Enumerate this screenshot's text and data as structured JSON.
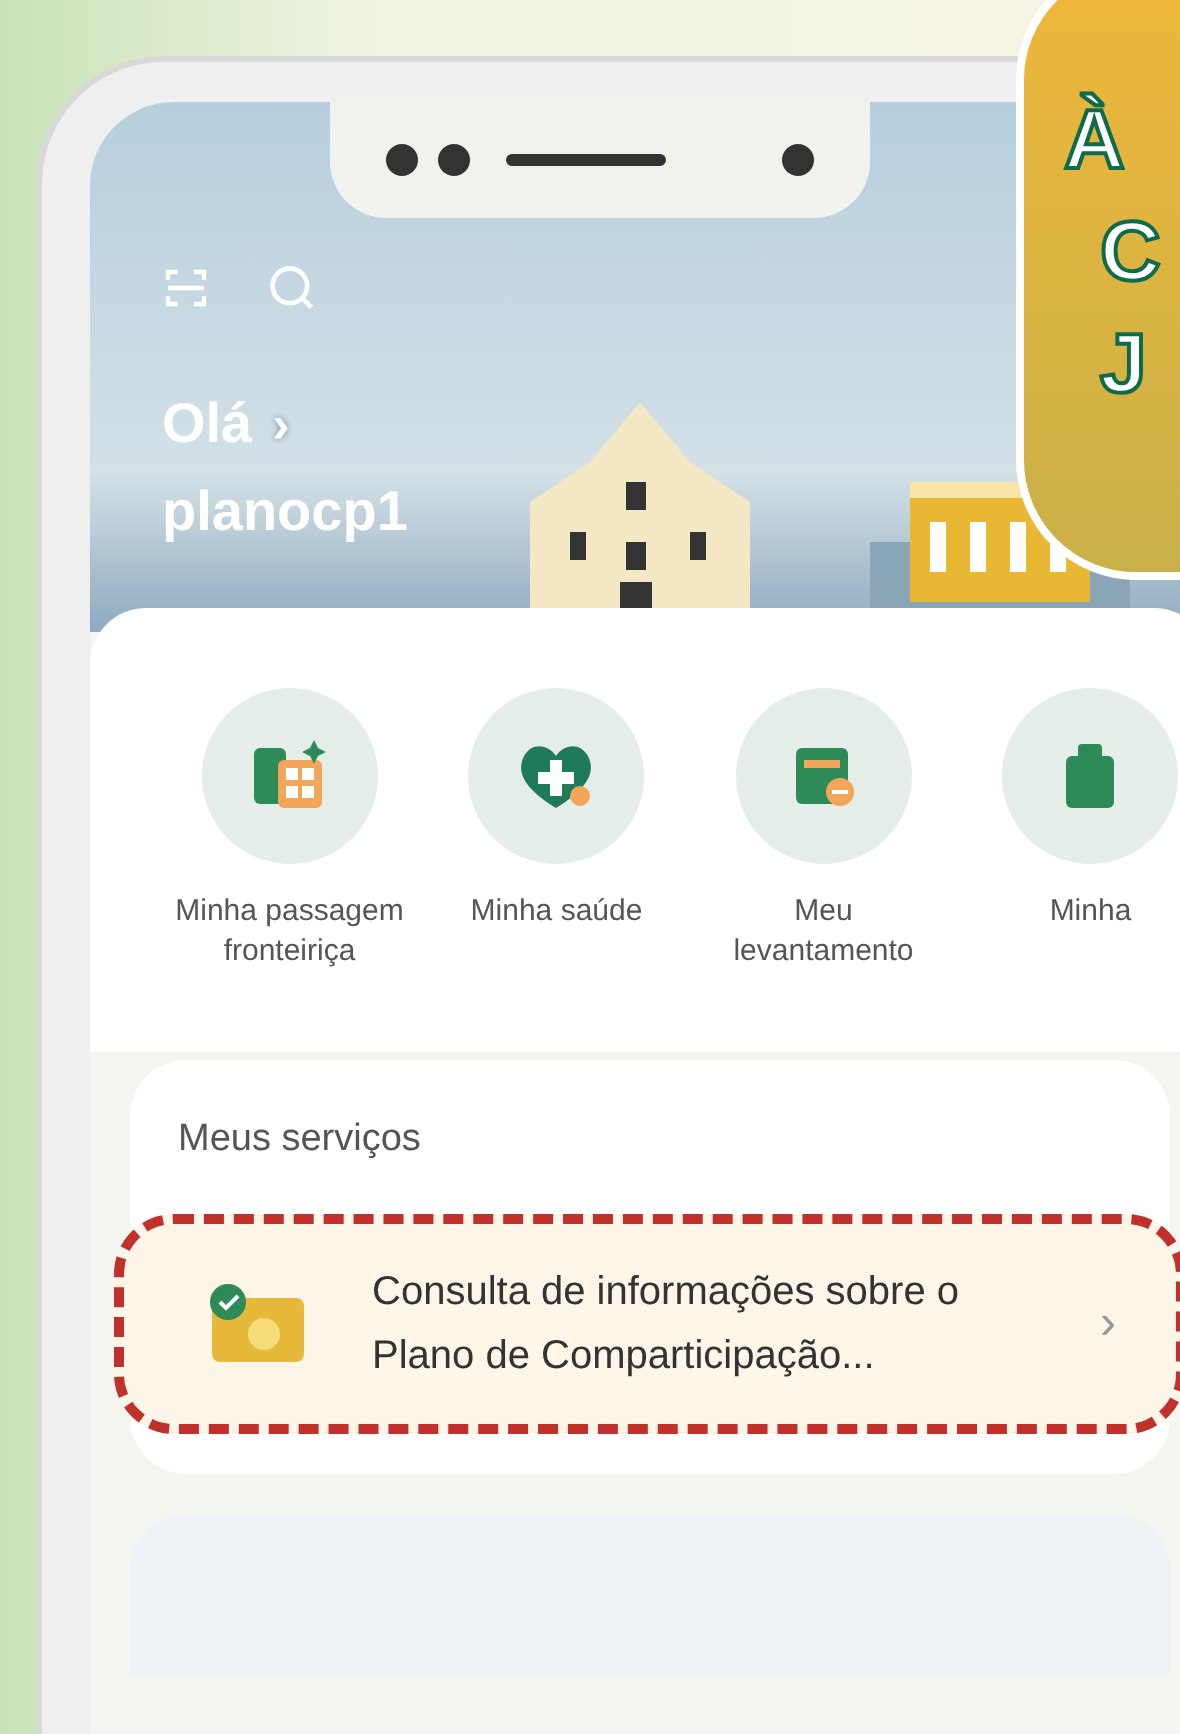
{
  "badge": {
    "lines": [
      "À",
      "C",
      "J"
    ]
  },
  "header": {
    "greeting": "Olá",
    "arrow": "›",
    "username": "planocp1"
  },
  "shortcuts": [
    {
      "kind": "border",
      "label": "Minha passagem fronteiriça"
    },
    {
      "kind": "health",
      "label": "Minha saúde"
    },
    {
      "kind": "withdrawal",
      "label": "Meu levantamento"
    },
    {
      "kind": "other",
      "label": "Minha"
    }
  ],
  "services": {
    "title": "Meus serviços",
    "items": [
      {
        "text": "Consulta de informações sobre o Plano de Comparticipação...",
        "chevron": "›",
        "highlighted": true
      }
    ]
  }
}
